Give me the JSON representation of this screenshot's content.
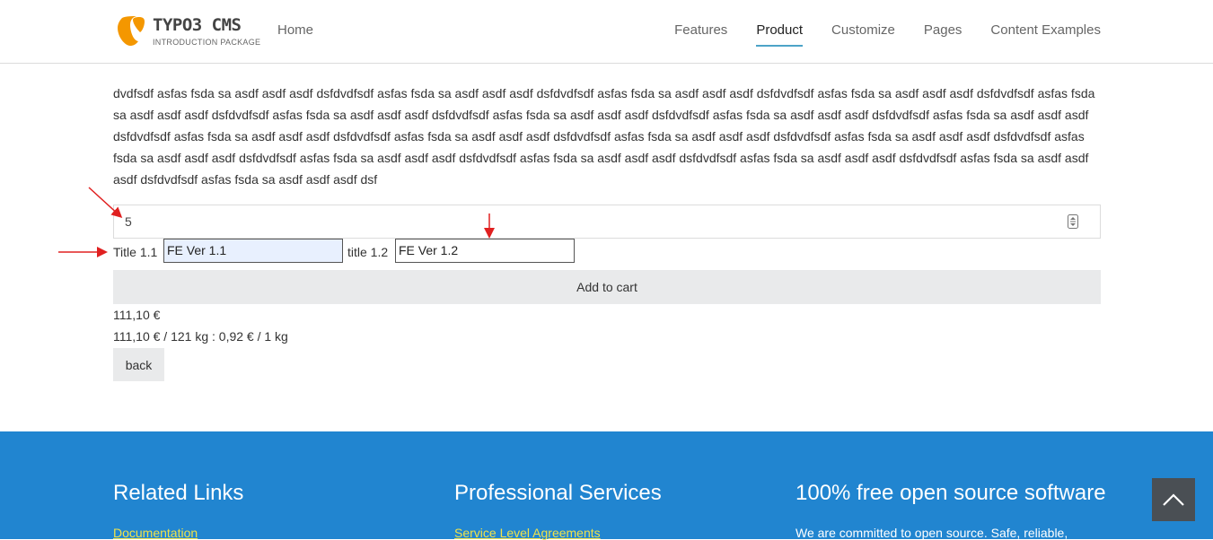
{
  "header": {
    "logo_title": "TYPO3 CMS",
    "logo_subtitle": "INTRODUCTION PACKAGE",
    "nav_home": "Home",
    "nav_items": [
      {
        "label": "Features"
      },
      {
        "label": "Product",
        "active": true
      },
      {
        "label": "Customize"
      },
      {
        "label": "Pages"
      },
      {
        "label": "Content Examples"
      }
    ]
  },
  "product": {
    "description": "dvdfsdf asfas fsda sa asdf asdf asdf dsfdvdfsdf asfas fsda sa asdf asdf asdf dsfdvdfsdf asfas fsda sa asdf asdf asdf dsfdvdfsdf asfas fsda sa asdf asdf asdf dsfdvdfsdf asfas fsda sa asdf asdf asdf dsfdvdfsdf asfas fsda sa asdf asdf asdf dsfdvdfsdf asfas fsda sa asdf asdf asdf dsfdvdfsdf asfas fsda sa asdf asdf asdf dsfdvdfsdf asfas fsda sa asdf asdf asdf dsfdvdfsdf asfas fsda sa asdf asdf asdf dsfdvdfsdf asfas fsda sa asdf asdf asdf dsfdvdfsdf asfas fsda sa asdf asdf asdf dsfdvdfsdf asfas fsda sa asdf asdf asdf dsfdvdfsdf asfas fsda sa asdf asdf asdf dsfdvdfsdf asfas fsda sa asdf asdf asdf dsfdvdfsdf asfas fsda sa asdf asdf asdf dsfdvdfsdf asfas fsda sa asdf asdf asdf dsfdvdfsdf asfas fsda sa asdf asdf asdf dsfdvdfsdf asfas fsda sa asdf asdf asdf dsf",
    "quantity": "5",
    "title_1_label": "Title 1.1",
    "title_1_value": "FE Ver 1.1",
    "title_2_label": "title 1.2",
    "title_2_value": "FE Ver 1.2",
    "add_to_cart": "Add to cart",
    "price": "111,10 €",
    "unit_price": "111,10 € / 121 kg : 0,92 € / 1 kg",
    "back": "back"
  },
  "footer": {
    "col1_heading": "Related Links",
    "col1_link": "Documentation",
    "col2_heading": "Professional Services",
    "col2_link": "Service Level Agreements",
    "col3_heading": "100% free open source software",
    "col3_text": "We are committed to open source. Safe, reliable,"
  },
  "colors": {
    "footer_bg": "#2185d0",
    "footer_link": "#f0e24a",
    "logo_orange": "#f49700",
    "annotation_arrow": "#e02020",
    "nav_active_underline": "#4ca3c7"
  },
  "icons": {
    "logo": "typo3-logo-icon",
    "quantity_stepper": "number-stepper-icon",
    "scroll_top": "chevron-up-icon"
  }
}
